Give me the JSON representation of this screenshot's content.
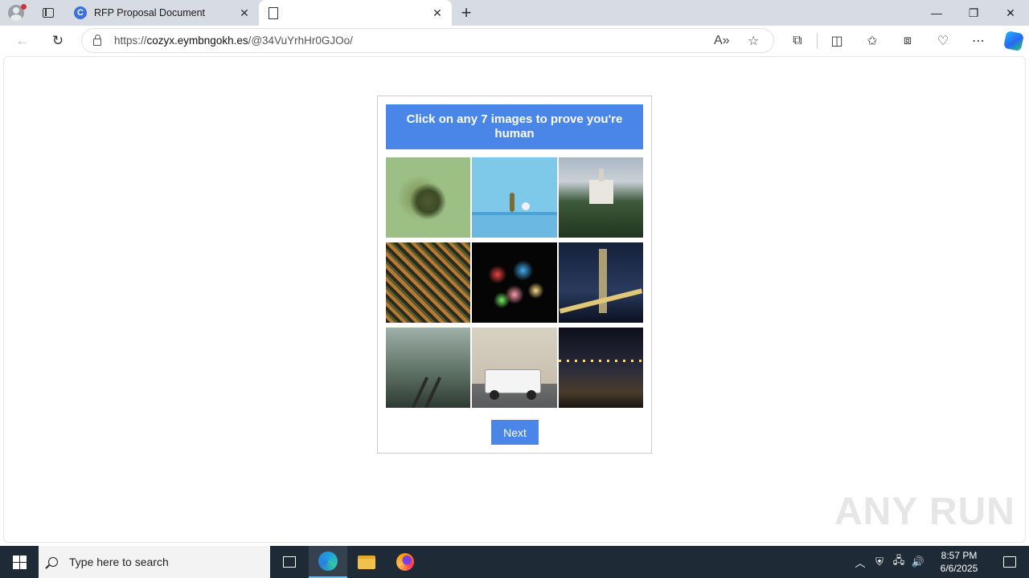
{
  "browser": {
    "tabs": [
      {
        "title": "RFP Proposal Document",
        "favicon": "c-logo-icon"
      },
      {
        "title": "",
        "favicon": "document-icon"
      }
    ],
    "url_prefix": "https://",
    "url_domain": "cozyx.eymbngokh.es",
    "url_path": "/@34VuYrhHr0GJOo/",
    "window_controls": {
      "minimize": "—",
      "restore": "❐",
      "close": "✕"
    }
  },
  "captcha": {
    "instruction": "Click on any 7 images to prove you're human",
    "tiles": [
      "frog-in-pond",
      "plant-on-blue-table",
      "castle-on-hill",
      "aerial-farmland",
      "fireworks",
      "bridge-at-night",
      "foggy-railway",
      "house-with-car",
      "city-street-night"
    ],
    "next_label": "Next",
    "accent_color": "#4a86e8"
  },
  "watermark": "ANY RUN",
  "taskbar": {
    "search_placeholder": "Type here to search",
    "time": "8:57 PM",
    "date": "6/6/2025"
  }
}
